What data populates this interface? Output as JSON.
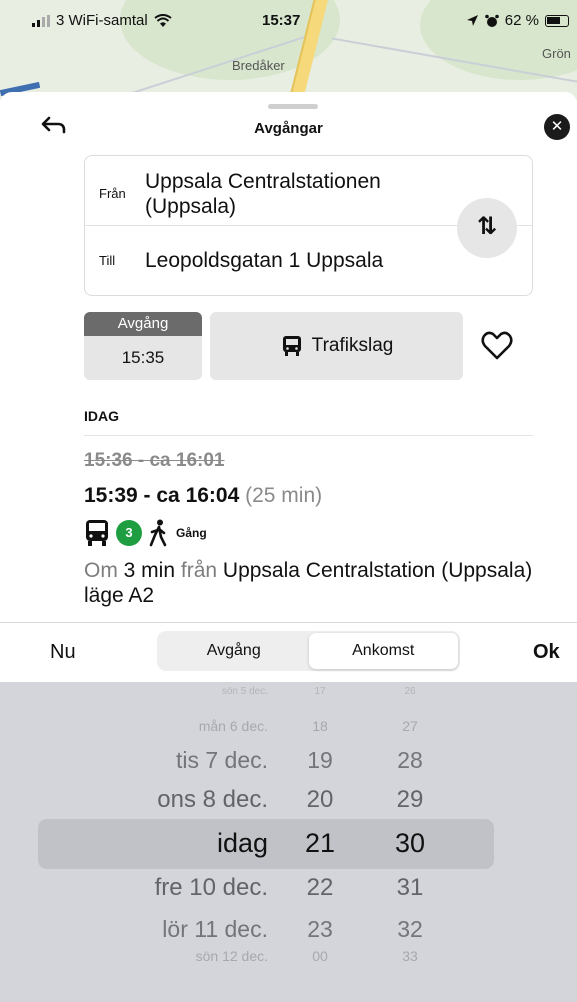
{
  "status_bar": {
    "carrier": "3 WiFi-samtal",
    "time": "15:37",
    "battery": "62 %"
  },
  "map": {
    "place_1": "Bredåker",
    "place_2": "Grön"
  },
  "sheet": {
    "title": "Avgångar",
    "from_label": "Från",
    "from_value": "Uppsala Centralstationen (Uppsala)",
    "to_label": "Till",
    "to_value": "Leopoldsgatan 1 Uppsala",
    "departure_tab_label": "Avgång",
    "departure_time": "15:35",
    "mode_label": "Trafikslag"
  },
  "results": {
    "day_header": "IDAG",
    "trip": {
      "old_time": "15:36 - ca 16:01",
      "new_time": "15:39 - ca 16:04",
      "duration": "(25 min)",
      "line_number": "3",
      "walk_label": "Gång",
      "info": {
        "om": "Om",
        "min": "3 min",
        "fran": "från",
        "stop": "Uppsala Centralstation",
        "tail": "(Uppsala) läge A2"
      }
    }
  },
  "picker_toolbar": {
    "now_label": "Nu",
    "ok_label": "Ok",
    "segments": [
      "Avgång",
      "Ankomst"
    ],
    "selected_segment": "Ankomst"
  },
  "picker": {
    "days": [
      "sön 5 dec.",
      "mån 6 dec.",
      "tis 7 dec.",
      "ons 8 dec.",
      "idag",
      "fre 10 dec.",
      "lör 11 dec.",
      "sön 12 dec."
    ],
    "hours": [
      "17",
      "18",
      "19",
      "20",
      "21",
      "22",
      "23",
      "00"
    ],
    "minutes": [
      "26",
      "27",
      "28",
      "29",
      "30",
      "31",
      "32",
      "33"
    ],
    "selected_day": "idag",
    "selected_hour": "21",
    "selected_minute": "30"
  },
  "colors": {
    "line_badge": "#1e9e40",
    "tab_header": "#6b6b6b",
    "picker_bg": "#d3d5db"
  },
  "icons": [
    "wifi-icon",
    "location-arrow-icon",
    "alarm-icon",
    "back-icon",
    "close-icon",
    "swap-icon",
    "bus-icon",
    "heart-icon",
    "walk-icon"
  ]
}
